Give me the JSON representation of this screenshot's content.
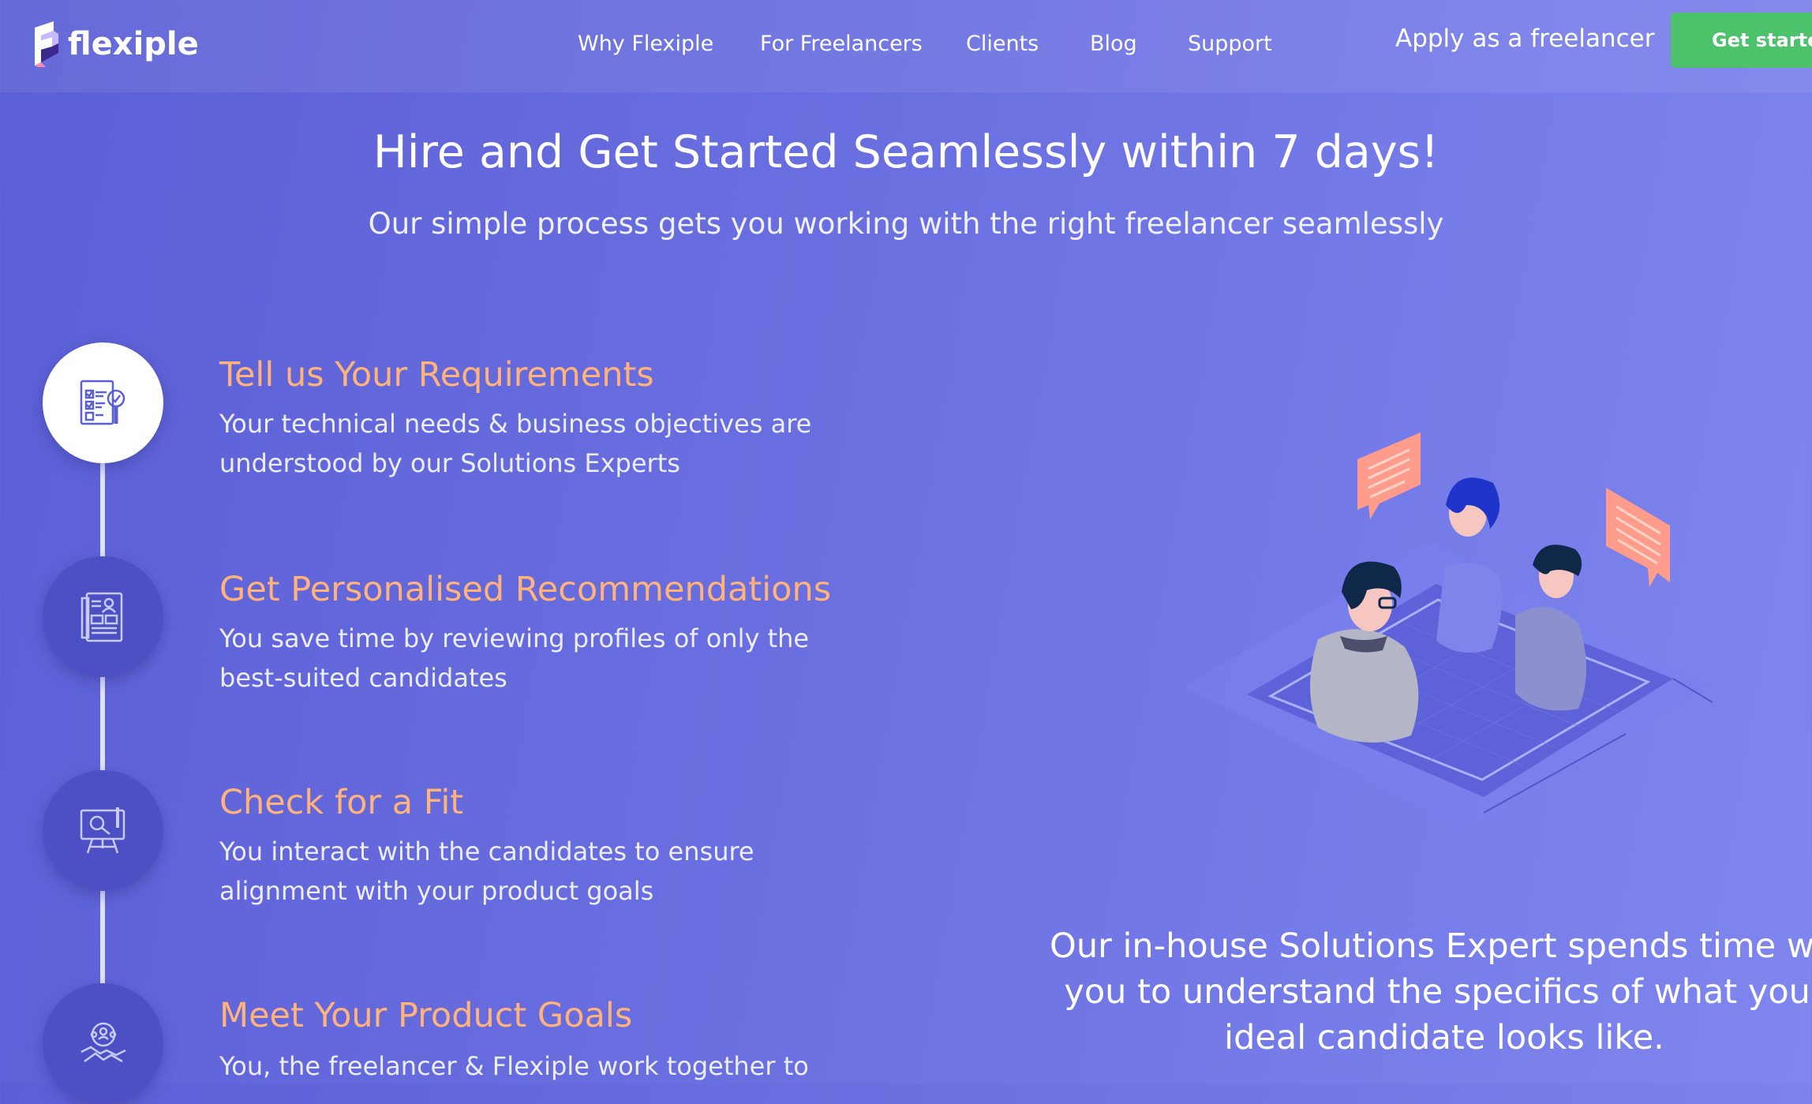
{
  "brand": {
    "name": "flexiple",
    "logo_icon": "flexiple-f-logo-icon"
  },
  "nav": {
    "links": [
      "Why Flexiple",
      "For Freelancers",
      "Clients",
      "Blog",
      "Support"
    ],
    "apply_label": "Apply as a freelancer",
    "cta_label": "Get started"
  },
  "hero": {
    "title": "Hire and Get Started Seamlessly within 7 days!",
    "subtitle": "Our simple process gets you working with the right freelancer seamlessly"
  },
  "steps": [
    {
      "title": "Tell us Your Requirements",
      "desc_line1": "Your technical needs & business objectives are",
      "desc_line2": "understood by our Solutions Experts",
      "icon": "requirements-checklist-icon",
      "active": true
    },
    {
      "title": "Get Personalised Recommendations",
      "desc_line1": "You save time by reviewing profiles of only the",
      "desc_line2": "best-suited candidates",
      "icon": "profiles-document-icon",
      "active": false
    },
    {
      "title": "Check for a Fit",
      "desc_line1": "You interact with the candidates to ensure",
      "desc_line2": "alignment with your product goals",
      "icon": "presentation-board-icon",
      "active": false
    },
    {
      "title": "Meet Your Product Goals",
      "desc_line1": "You, the freelancer & Flexiple work together to",
      "desc_line2": "",
      "icon": "team-handshake-icon",
      "active": false
    }
  ],
  "caption": {
    "line1": "Our in-house Solutions Expert spends time with",
    "line2": "you to understand the specifics of what your",
    "line3": "ideal candidate looks like."
  },
  "colors": {
    "accent_orange": "#ffb37a",
    "cta_green": "#4cc26a",
    "background": "#6a6fe0"
  }
}
